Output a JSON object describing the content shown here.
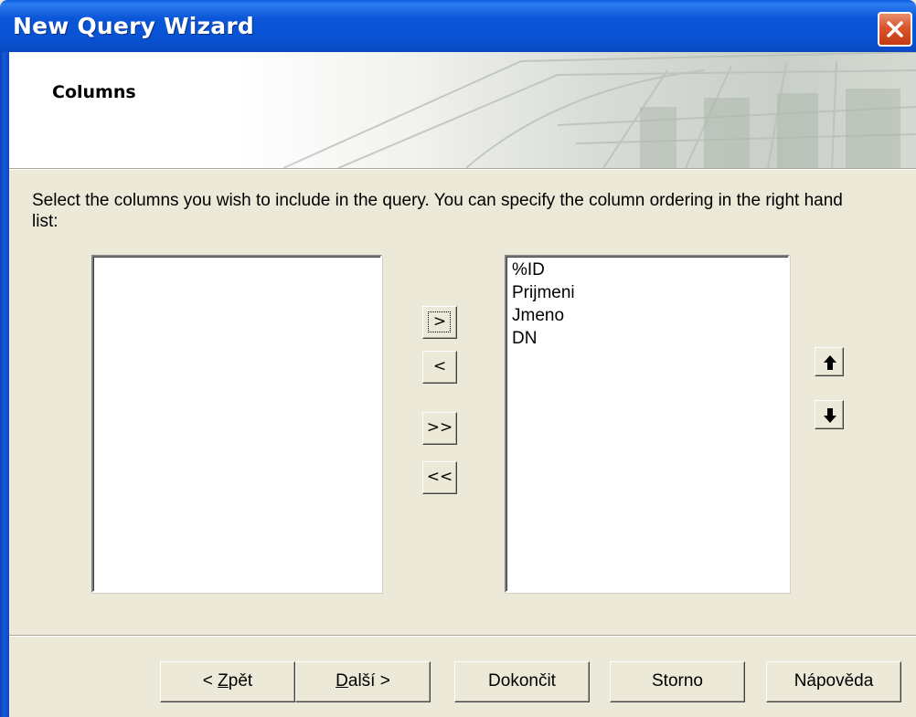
{
  "window": {
    "title": "New Query Wizard"
  },
  "header": {
    "title": "Columns"
  },
  "instructions": "Select the columns you wish to include in the query. You can specify the column ordering in the right hand list:",
  "available_columns": [],
  "selected_columns": [
    "%ID",
    "Prijmeni",
    "Jmeno",
    "DN"
  ],
  "transfer_buttons": {
    "add": ">",
    "remove": "<",
    "add_all": ">>",
    "remove_all": "<<"
  },
  "order_buttons": {
    "move_up_icon": "arrow-up-icon",
    "move_down_icon": "arrow-down-icon"
  },
  "footer": {
    "back_prefix": "< ",
    "back_mnemonic": "Z",
    "back_rest": "pět",
    "next_mnemonic": "D",
    "next_rest": "alší >",
    "finish": "Dokončit",
    "cancel": "Storno",
    "help": "Nápověda"
  },
  "colors": {
    "title_bar": "#0753d4",
    "dialog_face": "#ece9d8",
    "close_button": "#d9542c"
  }
}
